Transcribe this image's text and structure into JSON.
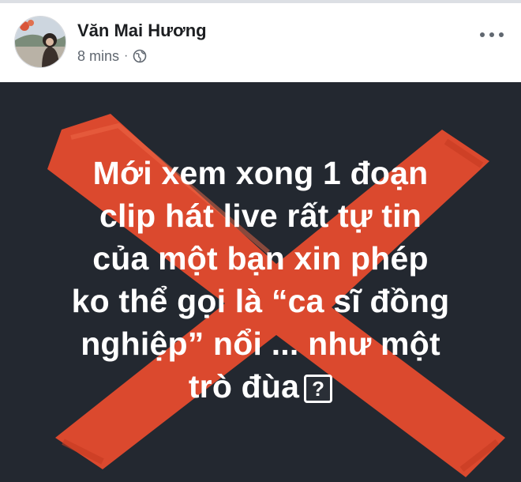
{
  "post": {
    "author": "Văn Mai Hương",
    "time": "8 mins",
    "separator": "·",
    "privacy_icon": "globe-icon",
    "menu_icon": "more-options-icon",
    "background_color": "#232830",
    "cross_color": "#e14a2e",
    "text_lines": [
      "Mới xem xong 1 đoạn",
      "clip hát live rất tự tin",
      "của một bạn xin phép",
      "ko thể gọi là “ca sĩ đồng",
      "nghiệp” nổi ... như một",
      "trò đùa"
    ],
    "end_symbol": "?"
  }
}
